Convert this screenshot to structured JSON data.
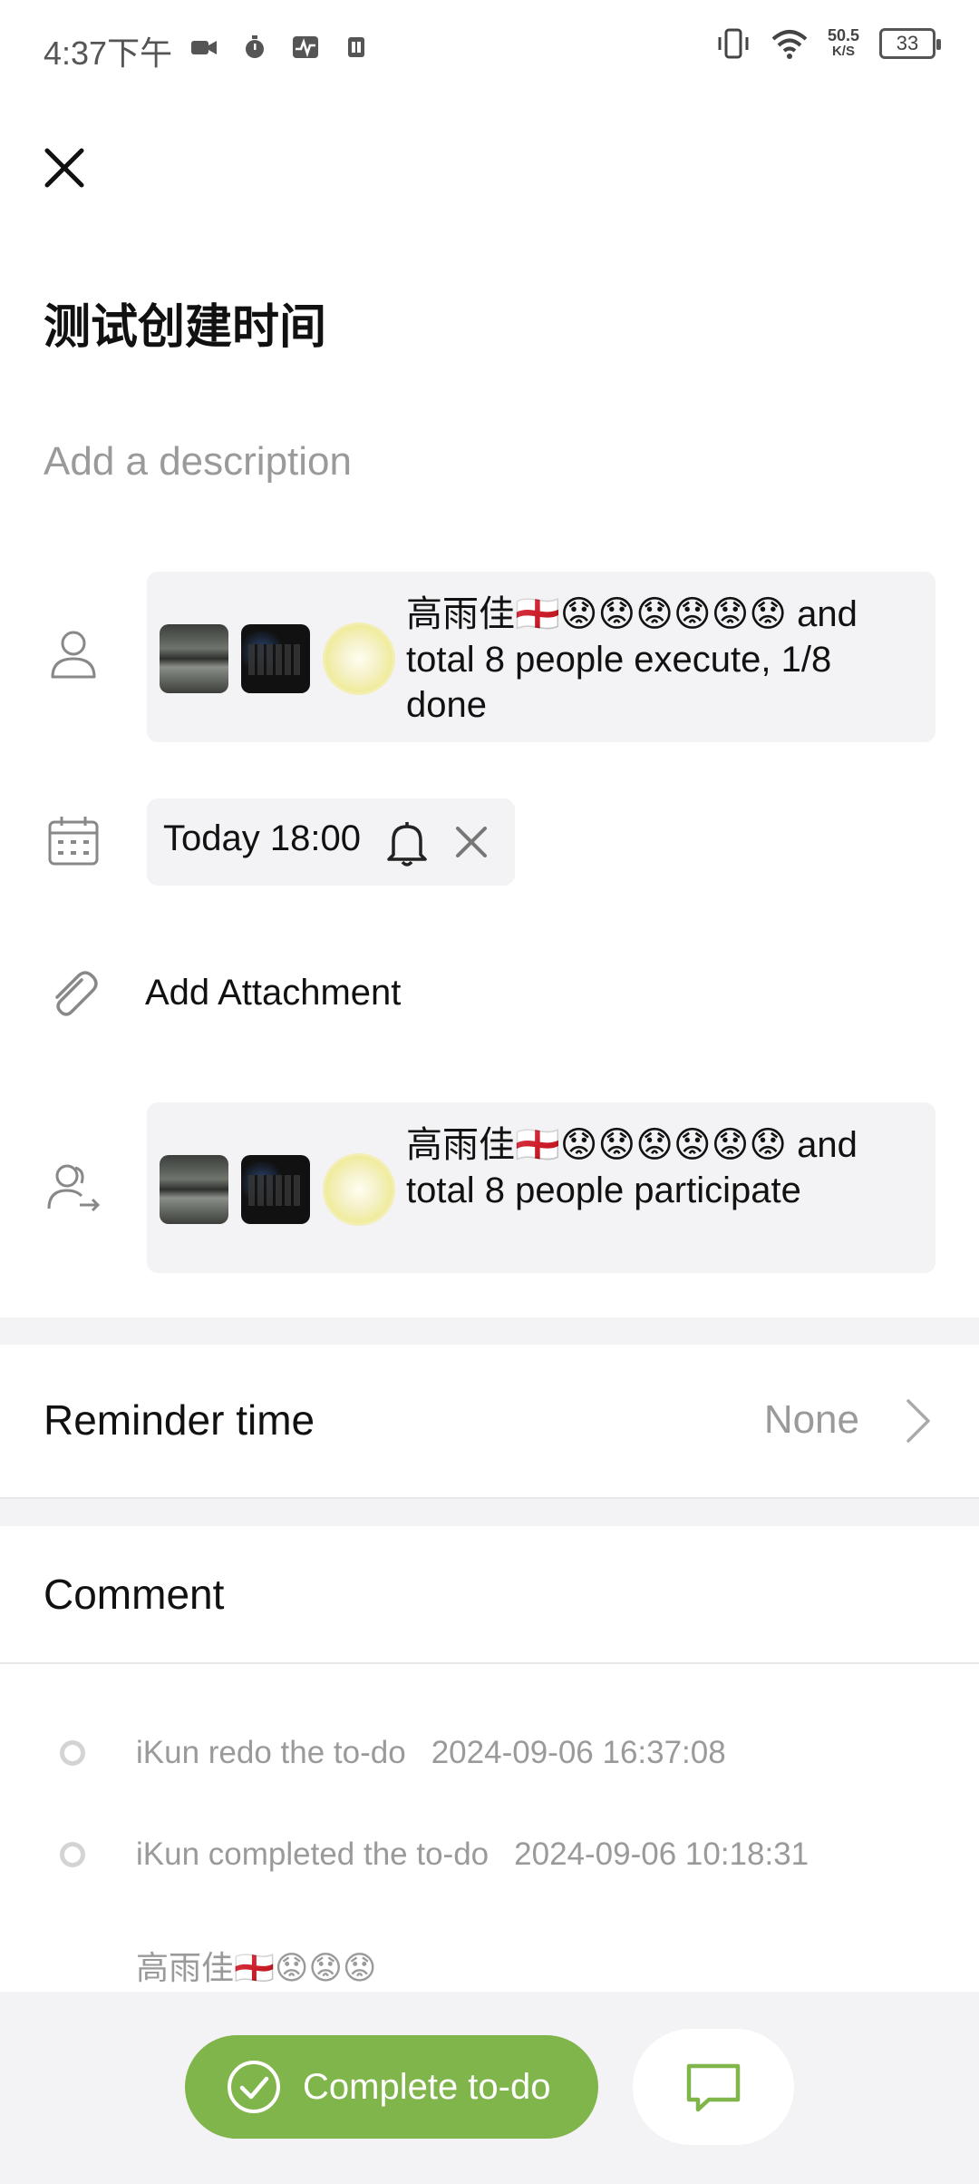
{
  "status_bar": {
    "time": "4:37下午",
    "net_speed_value": "50.5",
    "net_speed_unit": "K/S",
    "battery": "33"
  },
  "task": {
    "title": "测试创建时间",
    "description_placeholder": "Add a description"
  },
  "executors": {
    "summary": "高雨佳🏴󠁧󠁢󠁥󠁮󠁧󠁿😟😟😟😟😟😟 and total 8 people execute, 1/8 done"
  },
  "due": {
    "label": "Today 18:00"
  },
  "attachment": {
    "label": "Add Attachment"
  },
  "participants": {
    "summary": "高雨佳🏴󠁧󠁢󠁥󠁮󠁧󠁿😟😟😟😟😟😟 and total 8 people participate"
  },
  "reminder": {
    "label": "Reminder time",
    "value": "None"
  },
  "comments": {
    "title": "Comment",
    "logs": [
      {
        "text": "iKun redo the to-do",
        "time": "2024-09-06 16:37:08"
      },
      {
        "text": "iKun completed the to-do",
        "time": "2024-09-06 10:18:31"
      }
    ],
    "partial_entry": "高雨佳🏴󠁧󠁢󠁥󠁮󠁧󠁿😟😟😟"
  },
  "actions": {
    "complete_label": "Complete to-do"
  },
  "colors": {
    "accent_green": "#7fb54a",
    "muted_text": "#9a9a9a",
    "chip_bg": "#f3f3f5"
  }
}
